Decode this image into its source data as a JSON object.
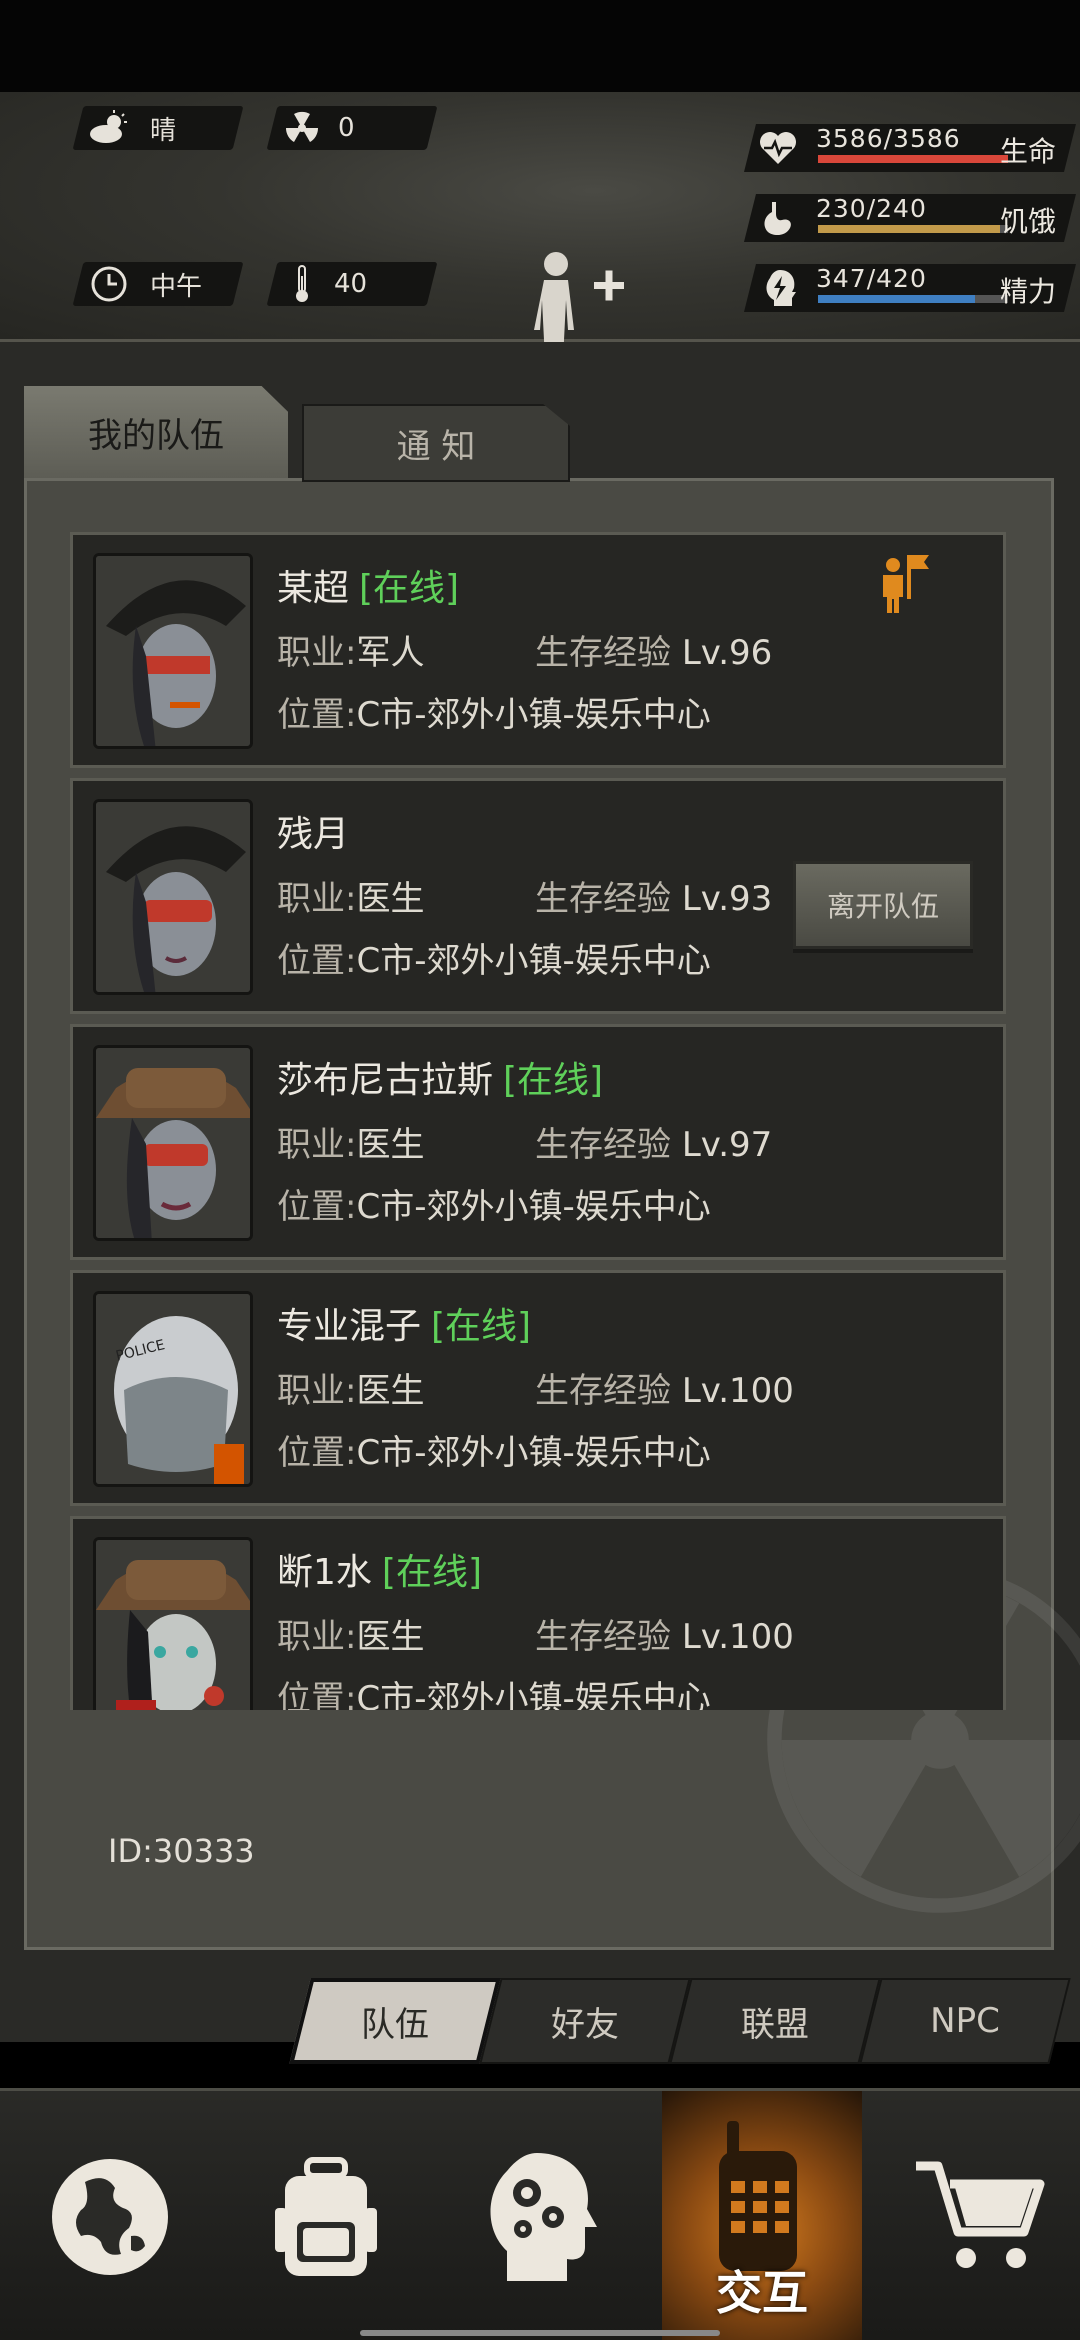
{
  "hud": {
    "weather": "晴",
    "radiation": "0",
    "time_of_day": "中午",
    "temperature": "40",
    "stats": [
      {
        "icon": "heart-icon",
        "value": "3586/3586",
        "label": "生命",
        "fill": 1.0,
        "color": "#d9473a"
      },
      {
        "icon": "stomach-icon",
        "value": "230/240",
        "label": "饥饿",
        "fill": 0.958,
        "color": "#c29a4a"
      },
      {
        "icon": "energy-head-icon",
        "value": "347/420",
        "label": "精力",
        "fill": 0.826,
        "color": "#3f7fc2"
      }
    ]
  },
  "tabs": {
    "my_team": "我的队伍",
    "notice": "通 知"
  },
  "labels": {
    "online": "[在线]",
    "job_prefix": "职业:",
    "exp_prefix": "生存经验",
    "location_prefix": "位置:",
    "leave_team": "离开队伍"
  },
  "members": [
    {
      "name": "某超",
      "online": true,
      "job": "军人",
      "level": "Lv.96",
      "location": "C市-郊外小镇-娱乐中心",
      "leader": true
    },
    {
      "name": "残月",
      "online": false,
      "job": "医生",
      "level": "Lv.93",
      "location": "C市-郊外小镇-娱乐中心",
      "leave_button": true
    },
    {
      "name": "莎布尼古拉斯",
      "online": true,
      "job": "医生",
      "level": "Lv.97",
      "location": "C市-郊外小镇-娱乐中心"
    },
    {
      "name": "专业混子",
      "online": true,
      "job": "医生",
      "level": "Lv.100",
      "location": "C市-郊外小镇-娱乐中心"
    },
    {
      "name": "断1水",
      "online": true,
      "job": "医生",
      "level": "Lv.100",
      "location": "C市-郊外小镇-娱乐中心"
    }
  ],
  "player_id": "ID:30333",
  "subtabs": [
    "队伍",
    "好友",
    "联盟",
    "NPC"
  ],
  "bottom_nav": {
    "active_label": "交互"
  },
  "colors": {
    "online": "#5fd05a",
    "accent": "#d27a1e"
  }
}
